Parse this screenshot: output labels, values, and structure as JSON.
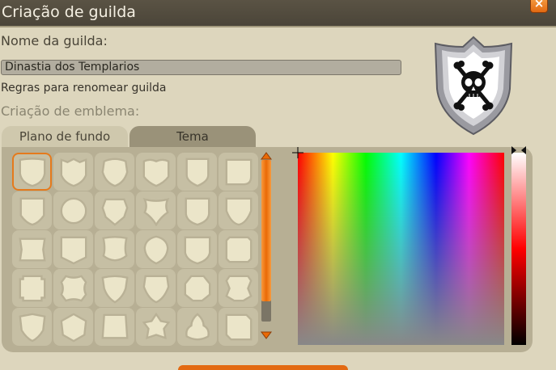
{
  "window": {
    "title": "Criação de guilda",
    "close_label": "×"
  },
  "guild": {
    "name_label": "Nome da guilda:",
    "name_value": "Dinastia dos Templarios",
    "rules_link": "Regras para renomear guilda"
  },
  "emblem": {
    "section_label": "Criação de emblema:",
    "tabs": [
      {
        "label": "Plano de fundo",
        "active": true
      },
      {
        "label": "Tema",
        "active": false
      }
    ],
    "selected_shape_index": 0,
    "shape_count": 30,
    "preview_icon": "skull-crossbones-icon",
    "background_color": "#ffffff"
  },
  "colors": {
    "accent": "#e36a12",
    "panel": "#b7af94",
    "window": "#ddd6bd",
    "title_bar": "#4b4539"
  }
}
